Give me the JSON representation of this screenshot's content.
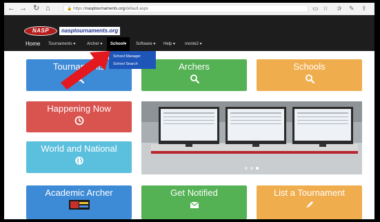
{
  "browser": {
    "nav_back": "←",
    "nav_forward": "→",
    "nav_refresh": "↻",
    "nav_home": "⌂",
    "url_prefix": "https://",
    "url_host": "nasptournaments.org",
    "url_path": "/default.aspx"
  },
  "header": {
    "logo_text": "NASP",
    "site_domain": "nasptournaments.org"
  },
  "nav": {
    "home": "Home",
    "tournaments": "Tournaments ▾",
    "archer": "Archer ▾",
    "school": "School▾",
    "software": "Software ▾",
    "help": "Help ▾",
    "user": "monte2 ▾"
  },
  "dropdown": {
    "school_manager": "School Manager",
    "school_search": "School Search"
  },
  "tiles": {
    "tournaments": "Tournaments",
    "archers": "Archers",
    "schools": "Schools",
    "happening_now": "Happening Now",
    "world_national": "World and National",
    "academic_archer": "Academic Archer",
    "get_notified": "Get Notified",
    "list_tournament": "List a Tournament"
  },
  "colors": {
    "blue": "#3d8ad6",
    "green": "#54b154",
    "orange": "#f0ad4e",
    "red": "#d9534f",
    "cyan": "#5bc0de",
    "nav_bg": "#1d1d1d",
    "dropdown_bg": "#1e55b8",
    "arrow": "#e3191f"
  },
  "slider": {
    "active_index": 2,
    "count": 3
  }
}
